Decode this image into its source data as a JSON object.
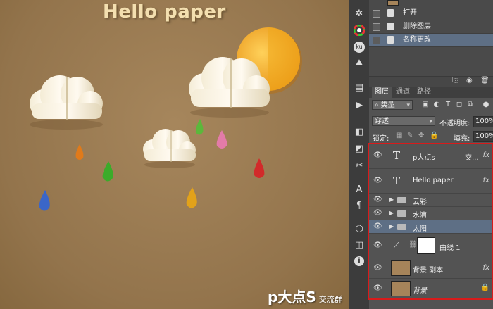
{
  "canvas": {
    "title": "Hello paper",
    "watermark_main": "p大点S",
    "watermark_sub": "交流群",
    "background_color": "#9b7b52"
  },
  "toolbar": {
    "icons": [
      "settings-icon",
      "color-wheel-icon",
      "kuler-icon",
      "navigator-icon",
      "history-icon",
      "actions-icon",
      "layers-icon",
      "channels-icon",
      "paths-icon",
      "adjustments-icon",
      "styles-icon",
      "character-icon",
      "paragraph-icon",
      "3d-icon",
      "properties-icon",
      "info-icon"
    ]
  },
  "history": {
    "items": [
      {
        "label": "打开",
        "selected": false
      },
      {
        "label": "删除图层",
        "selected": false
      },
      {
        "label": "名称更改",
        "selected": true
      }
    ]
  },
  "layers_panel": {
    "tabs": [
      {
        "label": "图层",
        "active": true
      },
      {
        "label": "通道",
        "active": false
      },
      {
        "label": "路径",
        "active": false
      }
    ],
    "filter_value": "类型",
    "blend_mode": "穿透",
    "opacity_label": "不透明度:",
    "opacity_value": "100%",
    "lock_label": "锁定:",
    "fill_label": "填充:",
    "fill_value": "100%",
    "layers": [
      {
        "name": "p大点s",
        "extra": "交...",
        "kind": "text",
        "fx": "fx"
      },
      {
        "name": "Hello paper",
        "kind": "text",
        "fx": "fx"
      },
      {
        "name": "云彩",
        "kind": "group"
      },
      {
        "name": "水滴",
        "kind": "group"
      },
      {
        "name": "太阳",
        "kind": "group",
        "selected": true
      },
      {
        "name": "曲线 1",
        "kind": "adjustment"
      },
      {
        "name": "背景 副本",
        "kind": "image",
        "fx": "fx"
      },
      {
        "name": "背景",
        "kind": "image",
        "locked": true
      }
    ]
  },
  "colors": {
    "highlight": "#d81b1b",
    "selection": "#5e6f85",
    "sun": "#f0a81c",
    "drops": [
      "#e07a1a",
      "#3bab2a",
      "#3a66c8",
      "#e2a21a",
      "#5bb83b",
      "#e37ba8",
      "#d22a2a"
    ]
  }
}
